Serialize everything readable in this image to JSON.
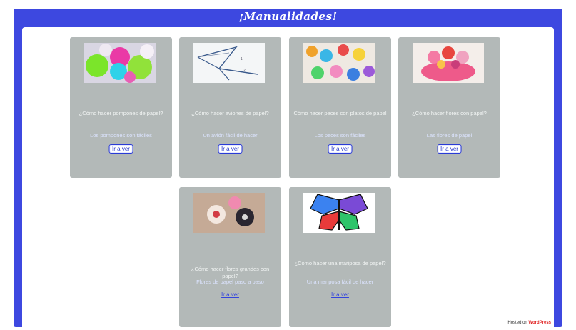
{
  "page": {
    "title": "¡Manualidades!"
  },
  "cards": [
    {
      "caption": "¿Cómo hacer pompones de papel?",
      "meta": "Los pompones son fáciles",
      "action": "Ir a ver"
    },
    {
      "caption": "¿Cómo hacer aviones de papel?",
      "meta": "Un avión fácil de hacer",
      "action": "Ir a ver"
    },
    {
      "caption": "Cómo hacer peces con platos de papel",
      "meta": "Los peces son fáciles",
      "action": "Ir a ver"
    },
    {
      "caption": "¿Cómo hacer flores con papel?",
      "meta": "Las flores de papel",
      "action": "Ir a ver"
    },
    {
      "caption": "¿Cómo hacer flores grandes con papel?",
      "meta": "Flores de papel paso a paso",
      "action": "Ir a ver"
    },
    {
      "caption": "¿Cómo hacer una mariposa de papel?",
      "meta": "Una mariposa fácil de hacer",
      "action": "Ir a ver"
    }
  ],
  "footer": {
    "prefix": "Hosted on",
    "brand": "WordPress"
  }
}
